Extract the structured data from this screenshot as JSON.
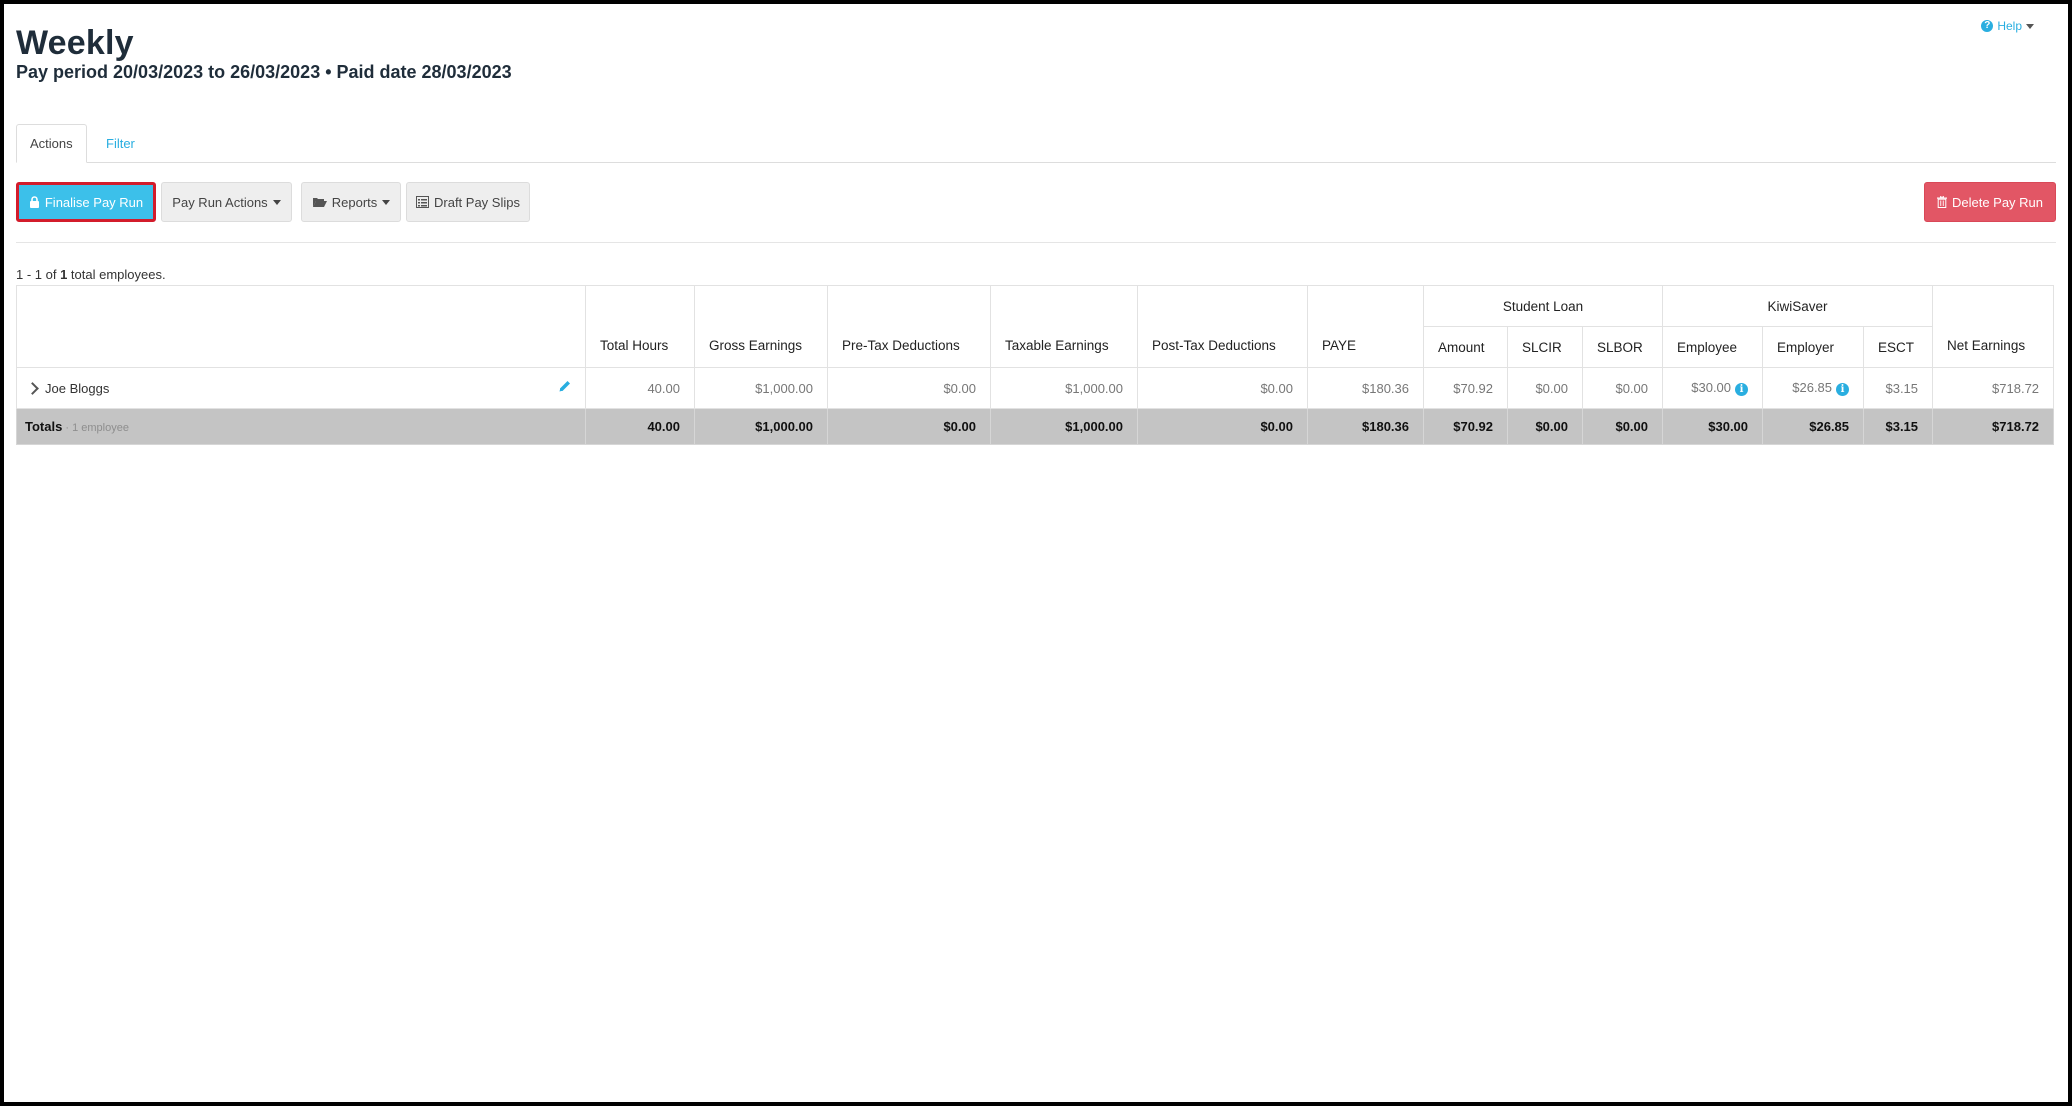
{
  "header": {
    "title": "Weekly",
    "subtitle": "Pay period 20/03/2023 to 26/03/2023 • Paid date 28/03/2023",
    "help_label": "Help"
  },
  "tabs": [
    {
      "label": "Actions",
      "active": true
    },
    {
      "label": "Filter",
      "active": false
    }
  ],
  "toolbar": {
    "finalise_label": "Finalise Pay Run",
    "pay_run_actions_label": "Pay Run Actions",
    "reports_label": "Reports",
    "draft_pay_slips_label": "Draft Pay Slips",
    "delete_label": "Delete Pay Run"
  },
  "summary": {
    "range": "1 - 1 of ",
    "count": "1",
    "suffix": " total employees."
  },
  "table": {
    "group_headers": {
      "student_loan": "Student Loan",
      "kiwisaver": "KiwiSaver"
    },
    "columns": {
      "total_hours": "Total Hours",
      "gross_earnings": "Gross Earnings",
      "pre_tax": "Pre-Tax Deductions",
      "taxable": "Taxable Earnings",
      "post_tax": "Post-Tax Deductions",
      "paye": "PAYE",
      "sl_amount": "Amount",
      "slcir": "SLCIR",
      "slbor": "SLBOR",
      "ks_employee": "Employee",
      "ks_employer": "Employer",
      "esct": "ESCT",
      "net": "Net Earnings"
    },
    "rows": [
      {
        "name": "Joe Bloggs",
        "total_hours": "40.00",
        "gross_earnings": "$1,000.00",
        "pre_tax": "$0.00",
        "taxable": "$1,000.00",
        "post_tax": "$0.00",
        "paye": "$180.36",
        "sl_amount": "$70.92",
        "slcir": "$0.00",
        "slbor": "$0.00",
        "ks_employee": "$30.00",
        "ks_employer": "$26.85",
        "esct": "$3.15",
        "net": "$718.72"
      }
    ],
    "totals": {
      "label": "Totals",
      "sub": " · 1 employee",
      "total_hours": "40.00",
      "gross_earnings": "$1,000.00",
      "pre_tax": "$0.00",
      "taxable": "$1,000.00",
      "post_tax": "$0.00",
      "paye": "$180.36",
      "sl_amount": "$70.92",
      "slcir": "$0.00",
      "slbor": "$0.00",
      "ks_employee": "$30.00",
      "ks_employer": "$26.85",
      "esct": "$3.15",
      "net": "$718.72"
    }
  },
  "colors": {
    "primary": "#3cc0ea",
    "danger": "#e25665",
    "link": "#29aee0",
    "totals_bg": "#c4c4c4",
    "highlight_border": "#d31c2b"
  },
  "icons": {
    "help": "question-circle-icon",
    "lock": "lock-icon",
    "folder": "folder-open-icon",
    "draft": "list-alt-icon",
    "trash": "trash-icon",
    "expand": "chevron-right-icon",
    "edit": "pencil-icon",
    "info": "info-circle-icon"
  }
}
